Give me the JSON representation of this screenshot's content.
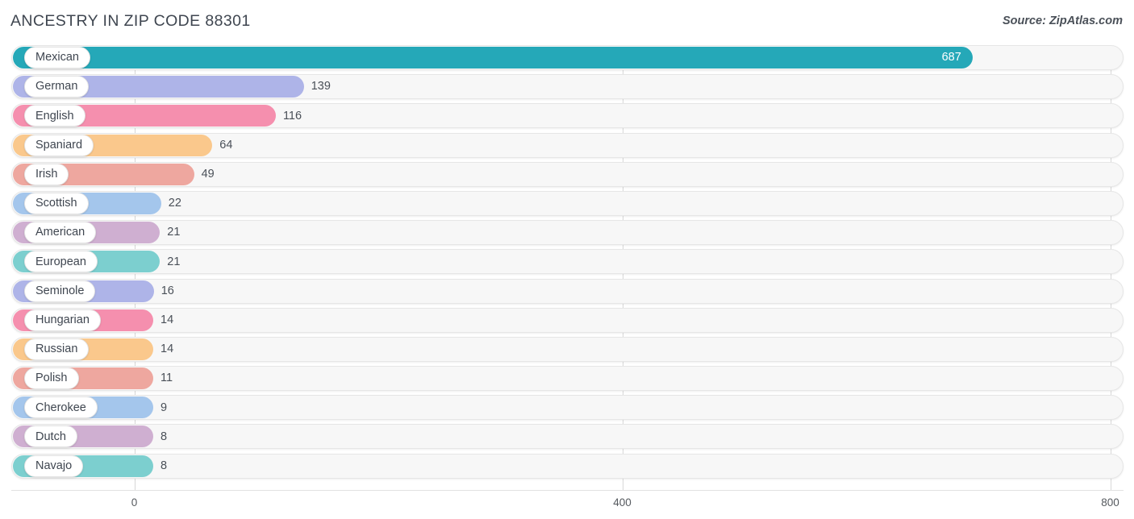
{
  "header": {
    "title": "ANCESTRY IN ZIP CODE 88301",
    "source": "Source: ZipAtlas.com"
  },
  "axis": {
    "ticks": [
      "0",
      "400",
      "800"
    ]
  },
  "chart_data": {
    "type": "bar",
    "orientation": "horizontal",
    "title": "ANCESTRY IN ZIP CODE 88301",
    "subtitle": "Source: ZipAtlas.com",
    "xlabel": "",
    "ylabel": "",
    "xlim": [
      0,
      800
    ],
    "xticks": [
      0,
      400,
      800
    ],
    "grid": true,
    "legend": "none",
    "categories": [
      "Mexican",
      "German",
      "English",
      "Spaniard",
      "Irish",
      "Scottish",
      "American",
      "European",
      "Seminole",
      "Hungarian",
      "Russian",
      "Polish",
      "Cherokee",
      "Dutch",
      "Navajo"
    ],
    "values": [
      687,
      139,
      116,
      64,
      49,
      22,
      21,
      21,
      16,
      14,
      14,
      11,
      9,
      8,
      8
    ],
    "colors": [
      "#25a8b8",
      "#aeb4e8",
      "#f58fae",
      "#fac88c",
      "#eea79f",
      "#a4c6ec",
      "#cfafd1",
      "#7ccfcf",
      "#aeb4e8",
      "#f58fae",
      "#fac88c",
      "#eea79f",
      "#a4c6ec",
      "#cfafd1",
      "#7ccfcf"
    ],
    "bars": [
      {
        "label": "Mexican",
        "value": 687,
        "value_text": "687",
        "color": "#25a8b8",
        "label_inside": true
      },
      {
        "label": "German",
        "value": 139,
        "value_text": "139",
        "color": "#aeb4e8",
        "label_inside": false
      },
      {
        "label": "English",
        "value": 116,
        "value_text": "116",
        "color": "#f58fae",
        "label_inside": false
      },
      {
        "label": "Spaniard",
        "value": 64,
        "value_text": "64",
        "color": "#fac88c",
        "label_inside": false
      },
      {
        "label": "Irish",
        "value": 49,
        "value_text": "49",
        "color": "#eea79f",
        "label_inside": false
      },
      {
        "label": "Scottish",
        "value": 22,
        "value_text": "22",
        "color": "#a4c6ec",
        "label_inside": false
      },
      {
        "label": "American",
        "value": 21,
        "value_text": "21",
        "color": "#cfafd1",
        "label_inside": false
      },
      {
        "label": "European",
        "value": 21,
        "value_text": "21",
        "color": "#7ccfcf",
        "label_inside": false
      },
      {
        "label": "Seminole",
        "value": 16,
        "value_text": "16",
        "color": "#aeb4e8",
        "label_inside": false
      },
      {
        "label": "Hungarian",
        "value": 14,
        "value_text": "14",
        "color": "#f58fae",
        "label_inside": false
      },
      {
        "label": "Russian",
        "value": 14,
        "value_text": "14",
        "color": "#fac88c",
        "label_inside": false
      },
      {
        "label": "Polish",
        "value": 11,
        "value_text": "11",
        "color": "#eea79f",
        "label_inside": false
      },
      {
        "label": "Cherokee",
        "value": 9,
        "value_text": "9",
        "color": "#a4c6ec",
        "label_inside": false
      },
      {
        "label": "Dutch",
        "value": 8,
        "value_text": "8",
        "color": "#cfafd1",
        "label_inside": false
      },
      {
        "label": "Navajo",
        "value": 8,
        "value_text": "8",
        "color": "#7ccfcf",
        "label_inside": false
      }
    ]
  }
}
